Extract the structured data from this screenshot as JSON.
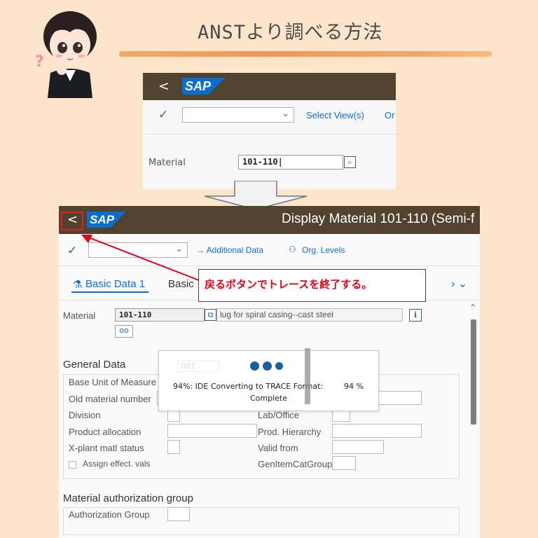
{
  "page_title": "ANSTより調べる方法",
  "avatar_question_mark": "?",
  "colors": {
    "background": "#fde5cc",
    "sap_shell": "#514330",
    "sap_blue": "#0a6ed1",
    "callout_red": "#e60012",
    "accent_orange": "#ee8f45"
  },
  "screen1": {
    "back_label": "<",
    "logo": "SAP",
    "ok_label": "✓",
    "dropdown_value": "",
    "select_views": "Select View(s)",
    "truncated_link": "Or",
    "material_label": "Material",
    "material_value": "101-110|"
  },
  "screen2": {
    "back_label": "<",
    "logo": "SAP",
    "window_title": "Display Material 101-110 (Semi-f",
    "ok_label": "✓",
    "dropdown_value": "",
    "additional_data": "→ Additional Data",
    "org_levels": "Org. Levels",
    "tabs": [
      "Basic Data 1",
      "Basic"
    ],
    "tab_nav": "› ⌄",
    "material_label": "Material",
    "material_value": "101-110",
    "material_desc": "lug for spiral casing--cast steel",
    "general_data_title": "General Data",
    "general_fields_left": [
      "Base Unit of Measure",
      "Old material number",
      "Division",
      "Product allocation",
      "X-plant matl status"
    ],
    "general_fields_right": [
      "Lab/Office",
      "Prod. Hierarchy",
      "Valid from",
      "GenItemCatGroup"
    ],
    "assign_effect_vals": "Assign effect. vals",
    "auth_group_title": "Material authorization group",
    "auth_group_label": "Authorization Group",
    "faded_field_value": "001"
  },
  "callout_text": "戻るボタンでトレースを終了する。",
  "progress": {
    "message": "94%: IDE Converting to TRACE Format:",
    "message_line2": "Complete",
    "percent_label": "94 %",
    "percent_value": 94
  }
}
